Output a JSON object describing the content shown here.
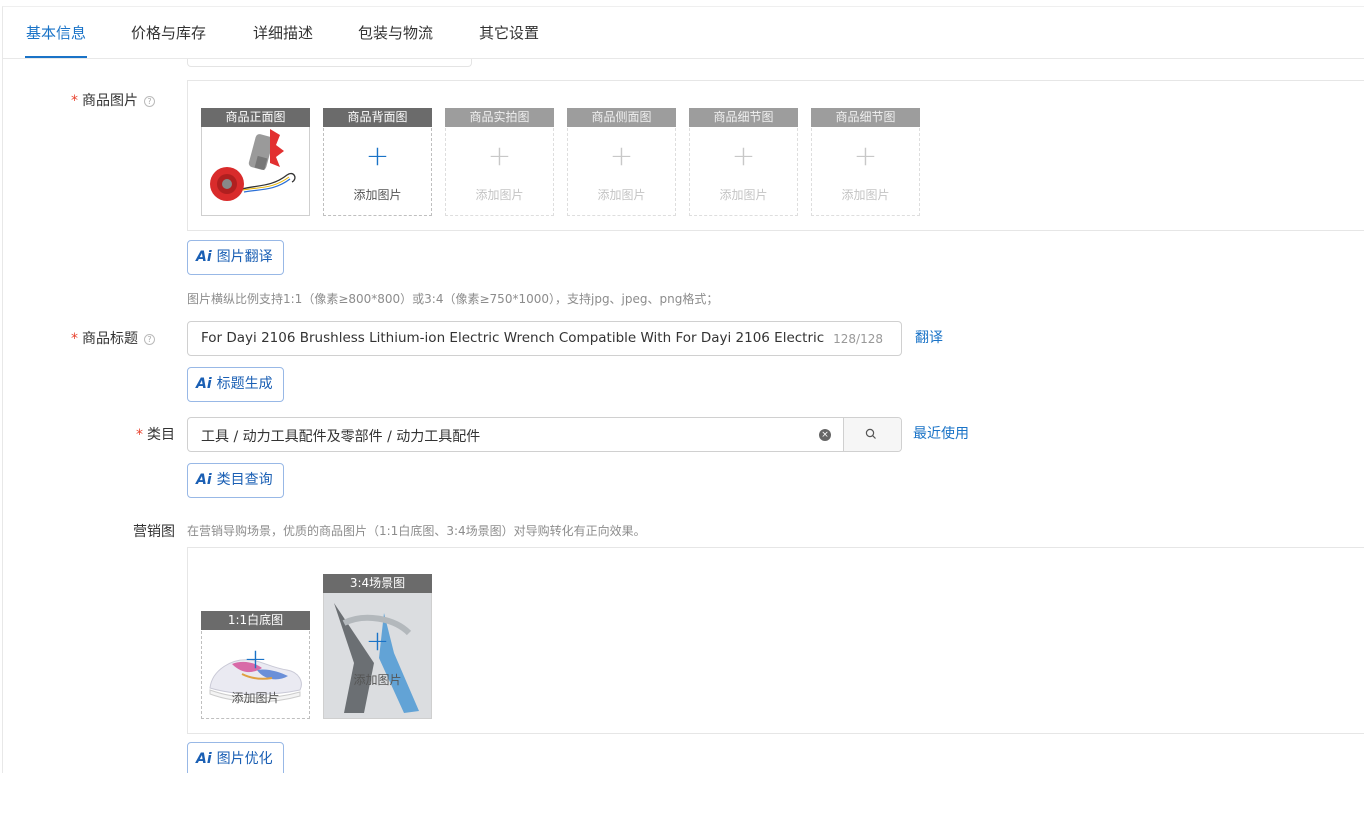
{
  "tabs": [
    {
      "label": "基本信息",
      "active": true
    },
    {
      "label": "价格与库存"
    },
    {
      "label": "详细描述"
    },
    {
      "label": "包装与物流"
    },
    {
      "label": "其它设置"
    }
  ],
  "colors": {
    "accent": "#1a73c7",
    "required": "#e8422e",
    "slot_header": "#6b6b6b"
  },
  "product_images": {
    "label": "商品图片",
    "required_mark": "*",
    "help_icon": "question-circle-icon",
    "slots": [
      {
        "title": "商品正面图",
        "add_text": ""
      },
      {
        "title": "商品背面图",
        "add_text": "添加图片"
      },
      {
        "title": "商品实拍图",
        "add_text": "添加图片"
      },
      {
        "title": "商品侧面图",
        "add_text": "添加图片"
      },
      {
        "title": "商品细节图",
        "add_text": "添加图片"
      },
      {
        "title": "商品细节图",
        "add_text": "添加图片"
      }
    ],
    "ai_button": "图片翻译",
    "hint": "图片横纵比例支持1:1（像素≥800*800）或3:4（像素≥750*1000），支持jpg、jpeg、png格式；"
  },
  "product_title": {
    "label": "商品标题",
    "required_mark": "*",
    "value": "For Dayi 2106 Brushless Lithium-ion Electric Wrench Compatible With For Dayi 2106 Electric",
    "counter": "128/128",
    "translate_link": "翻译",
    "ai_button": "标题生成"
  },
  "category": {
    "label": "类目",
    "required_mark": "*",
    "value": "工具 / 动力工具配件及零部件 / 动力工具配件",
    "recent_link": "最近使用",
    "ai_button": "类目查询",
    "clear_icon": "close-circle-icon",
    "search_icon": "search-icon"
  },
  "marketing": {
    "label": "营销图",
    "hint": "在营销导购场景，优质的商品图片（1:1白底图、3:4场景图）对导购转化有正向效果。",
    "slots": [
      {
        "title": "1:1白底图",
        "add_text": "添加图片"
      },
      {
        "title": "3:4场景图",
        "add_text": "添加图片"
      }
    ],
    "ai_button": "图片优化"
  },
  "ai_mark": "Ai"
}
